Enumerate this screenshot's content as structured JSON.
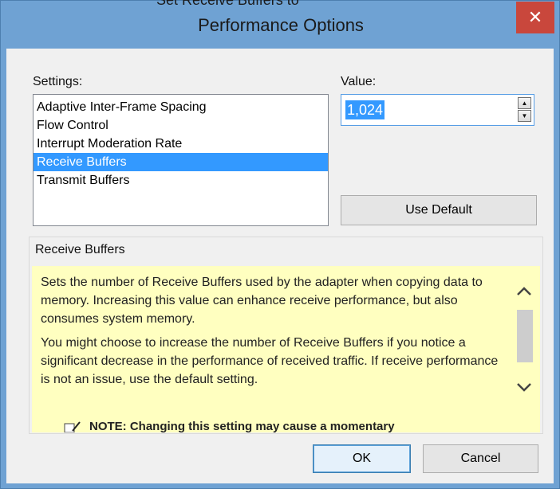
{
  "window": {
    "title": "Performance Options",
    "clipped_top_text": "Set Receive Buffers to"
  },
  "settings": {
    "label": "Settings:",
    "items": [
      {
        "label": "Adaptive Inter-Frame Spacing",
        "selected": false
      },
      {
        "label": "Flow Control",
        "selected": false
      },
      {
        "label": "Interrupt Moderation Rate",
        "selected": false
      },
      {
        "label": "Receive Buffers",
        "selected": true
      },
      {
        "label": "Transmit Buffers",
        "selected": false
      }
    ]
  },
  "value": {
    "label": "Value:",
    "current": "1,024"
  },
  "buttons": {
    "use_default": "Use Default",
    "ok": "OK",
    "cancel": "Cancel"
  },
  "description": {
    "header": "Receive Buffers",
    "paragraphs": [
      "Sets the number of Receive Buffers used by the adapter when copying data to memory. Increasing this value can enhance receive performance, but also consumes system memory.",
      "You might choose to increase the number of Receive Buffers if you notice a significant decrease in the performance of received traffic. If receive performance is not an issue, use the default setting."
    ],
    "note_partial": "NOTE: Changing this setting may cause a momentary"
  },
  "colors": {
    "selection": "#3399ff",
    "description_bg": "#ffffc0",
    "close_button": "#c9473c",
    "frame": "#6fa2d3"
  }
}
